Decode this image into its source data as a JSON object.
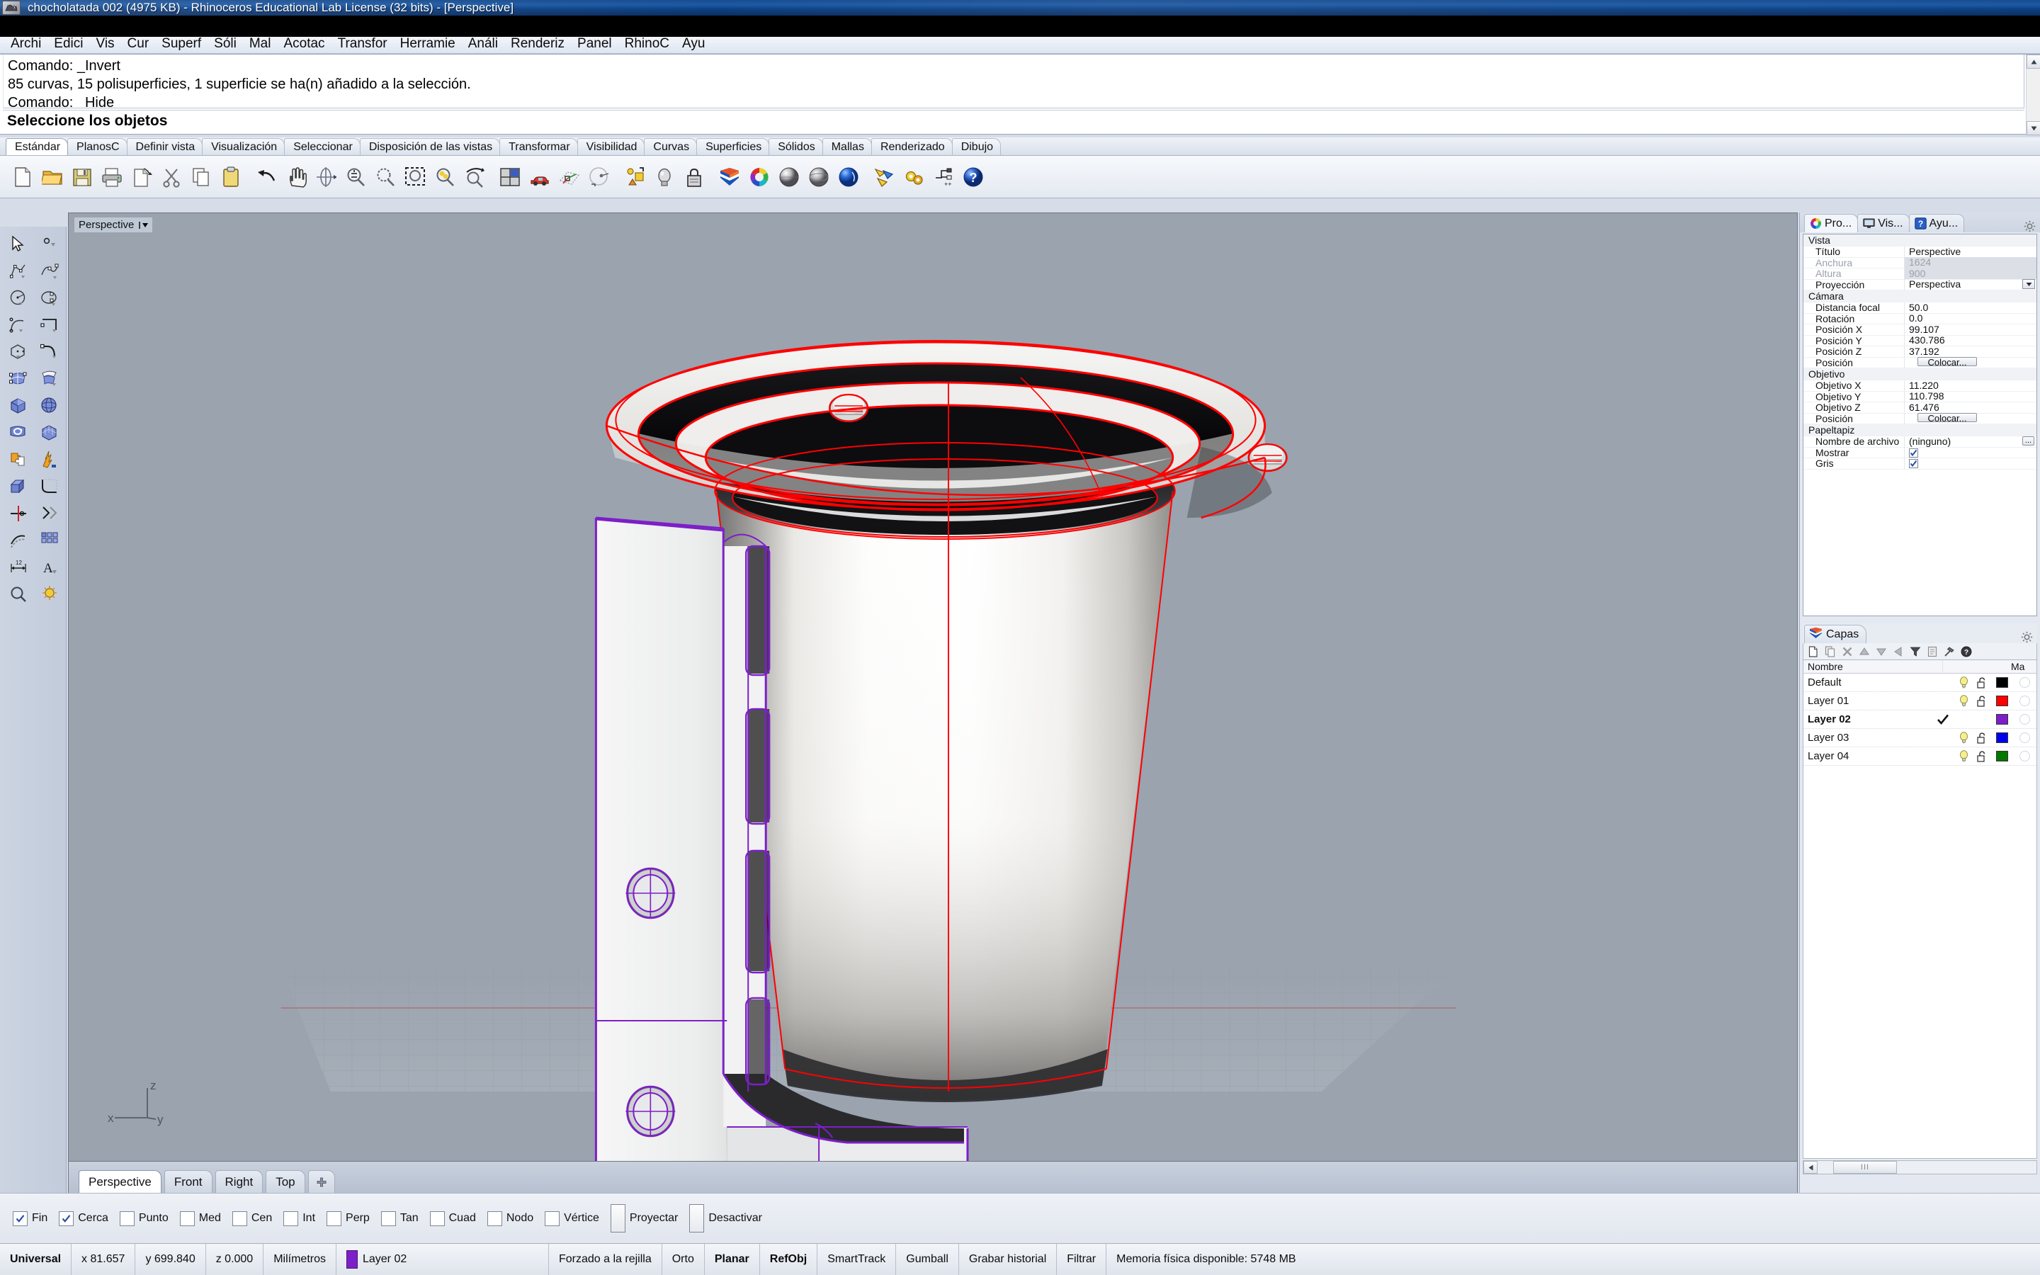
{
  "titlebar": {
    "text": "chocholatada 002 (4975 KB) - Rhinoceros Educational Lab License (32 bits) - [Perspective]",
    "icon": "rhino-logo-icon"
  },
  "menu": {
    "items": [
      {
        "label": "Archi"
      },
      {
        "label": "Edici"
      },
      {
        "label": "Vis"
      },
      {
        "label": "Cur"
      },
      {
        "label": "Superf"
      },
      {
        "label": "Sóli"
      },
      {
        "label": "Mal"
      },
      {
        "label": "Acotac"
      },
      {
        "label": "Transfor"
      },
      {
        "label": "Herramie"
      },
      {
        "label": "Análi"
      },
      {
        "label": "Renderiz"
      },
      {
        "label": "Panel"
      },
      {
        "label": "RhinoC"
      },
      {
        "label": "Ayu"
      }
    ]
  },
  "command": {
    "history": [
      "Comando: _Invert",
      "85 curvas, 15 polisuperficies, 1 superficie se ha(n) añadido a la selección.",
      "Comando: _Hide"
    ],
    "prompt": "Seleccione los objetos"
  },
  "toolbar_tabs": {
    "items": [
      {
        "label": "Estándar",
        "active": true
      },
      {
        "label": "PlanosC",
        "active": false
      },
      {
        "label": "Definir vista",
        "active": false
      },
      {
        "label": "Visualización",
        "active": false
      },
      {
        "label": "Seleccionar",
        "active": false
      },
      {
        "label": "Disposición de las vistas",
        "active": false
      },
      {
        "label": "Transformar",
        "active": false
      },
      {
        "label": "Visibilidad",
        "active": false
      },
      {
        "label": "Curvas",
        "active": false
      },
      {
        "label": "Superficies",
        "active": false
      },
      {
        "label": "Sólidos",
        "active": false
      },
      {
        "label": "Mallas",
        "active": false
      },
      {
        "label": "Renderizado",
        "active": false
      },
      {
        "label": "Dibujo",
        "active": false
      }
    ]
  },
  "main_toolbar": {
    "icons": [
      "new-file-icon",
      "open-folder-icon",
      "save-icon",
      "print-icon",
      "export-icon",
      "cut-scissors-icon",
      "copy-icon",
      "paste-clipboard-icon",
      "undo-arrow-icon",
      "pan-hand-icon",
      "rotate-view-icon",
      "zoom-in-out-icon",
      "zoom-extents-icon",
      "zoom-window-icon",
      "zoom-selected-icon",
      "zoom-dynamic-icon",
      "viewport-layout-icon",
      "render-preview-icon",
      "cplane-icon",
      "named-view-icon",
      "properties-icon",
      "light-bulb-icon",
      "lock-icon",
      "layers-icon",
      "color-wheel-icon",
      "shaded-sphere-icon",
      "rendered-sphere-icon",
      "ghosted-sphere-icon",
      "select-filter-icon",
      "options-gear-icon",
      "macro-icon",
      "help-icon"
    ]
  },
  "side_toolbar": {
    "icons": [
      "select-arrow-icon",
      "point-object-icon",
      "polyline-icon",
      "control-point-curve-icon",
      "circle-icon",
      "ellipse-icon",
      "arc-icon",
      "rectangle-icon",
      "polygon-icon",
      "curve-tools-icon",
      "surface-from-points-icon",
      "loft-surface-icon",
      "box-solid-icon",
      "sphere-solid-icon",
      "revolve-surface-icon",
      "mesh-box-icon",
      "boolean-union-icon",
      "explode-icon",
      "extrude-icon",
      "fillet-icon",
      "trim-icon",
      "split-icon",
      "offset-icon",
      "array-icon",
      "dimension-icon",
      "text-icon",
      "analyze-icon",
      "render-tools-icon"
    ]
  },
  "viewport": {
    "label": "Perspective",
    "axis": {
      "x": "x",
      "y": "y",
      "z": "z"
    },
    "background_color": "#9aa3ae",
    "selected_curve_color": "#ff0000",
    "layer02_color": "#7d1fc8",
    "tabs": [
      {
        "label": "Perspective",
        "active": true
      },
      {
        "label": "Front",
        "active": false
      },
      {
        "label": "Right",
        "active": false
      },
      {
        "label": "Top",
        "active": false
      }
    ],
    "add_tab_icon": "plus-icon"
  },
  "properties_panel": {
    "tabs": [
      {
        "label": "Pro...",
        "icon": "color-wheel-icon",
        "active": true
      },
      {
        "label": "Vis...",
        "icon": "monitor-icon",
        "active": false
      },
      {
        "label": "Ayu...",
        "icon": "help-blue-icon",
        "active": false
      }
    ],
    "gear_icon": "gear-icon",
    "groups": [
      {
        "title": "Vista",
        "rows": [
          {
            "key": "Título",
            "value": "Perspective",
            "style": "normal"
          },
          {
            "key": "Anchura",
            "value": "1624",
            "style": "dim"
          },
          {
            "key": "Altura",
            "value": "900",
            "style": "dim"
          },
          {
            "key": "Proyección",
            "value": "Perspectiva",
            "style": "dropdown"
          }
        ]
      },
      {
        "title": "Cámara",
        "rows": [
          {
            "key": "Distancia focal",
            "value": "50.0",
            "style": "normal"
          },
          {
            "key": "Rotación",
            "value": "0.0",
            "style": "normal"
          },
          {
            "key": "Posición X",
            "value": "99.107",
            "style": "normal"
          },
          {
            "key": "Posición Y",
            "value": "430.786",
            "style": "normal"
          },
          {
            "key": "Posición Z",
            "value": "37.192",
            "style": "normal"
          },
          {
            "key": "Posición",
            "value": "Colocar...",
            "style": "button"
          }
        ]
      },
      {
        "title": "Objetivo",
        "rows": [
          {
            "key": "Objetivo X",
            "value": "11.220",
            "style": "normal"
          },
          {
            "key": "Objetivo Y",
            "value": "110.798",
            "style": "normal"
          },
          {
            "key": "Objetivo Z",
            "value": "61.476",
            "style": "normal"
          },
          {
            "key": "Posición",
            "value": "Colocar...",
            "style": "button"
          }
        ]
      },
      {
        "title": "Papeltapiz",
        "rows": [
          {
            "key": "Nombre de archivo",
            "value": "(ninguno)",
            "style": "ellipsis-button"
          },
          {
            "key": "Mostrar",
            "value": "",
            "style": "checkbox"
          },
          {
            "key": "Gris",
            "value": "",
            "style": "checkbox"
          }
        ]
      }
    ]
  },
  "layers_panel": {
    "tab_label": "Capas",
    "tab_icon": "layers-shield-icon",
    "gear_icon": "gear-icon",
    "toolbar_icons": [
      "new-layer-icon",
      "copy-layer-icon",
      "delete-layer-icon",
      "move-up-icon",
      "move-down-icon",
      "move-left-icon",
      "filter-funnel-icon",
      "layer-props-icon",
      "layer-tools-hammer-icon",
      "layer-help-icon"
    ],
    "columns": [
      "Nombre",
      "",
      "",
      "",
      "",
      "Ma"
    ],
    "rows": [
      {
        "name": "Default",
        "active": false,
        "visible": true,
        "locked": false,
        "color": "#000000"
      },
      {
        "name": "Layer 01",
        "active": false,
        "visible": true,
        "locked": false,
        "color": "#ff0000"
      },
      {
        "name": "Layer 02",
        "active": true,
        "visible": true,
        "locked": false,
        "color": "#7d1fc8"
      },
      {
        "name": "Layer 03",
        "active": false,
        "visible": true,
        "locked": false,
        "color": "#0000ee"
      },
      {
        "name": "Layer 04",
        "active": false,
        "visible": true,
        "locked": false,
        "color": "#007700"
      }
    ]
  },
  "osnap_bar": {
    "items": [
      {
        "label": "Fin",
        "checked": true,
        "tall": false
      },
      {
        "label": "Cerca",
        "checked": true,
        "tall": false
      },
      {
        "label": "Punto",
        "checked": false,
        "tall": false
      },
      {
        "label": "Med",
        "checked": false,
        "tall": false
      },
      {
        "label": "Cen",
        "checked": false,
        "tall": false
      },
      {
        "label": "Int",
        "checked": false,
        "tall": false
      },
      {
        "label": "Perp",
        "checked": false,
        "tall": false
      },
      {
        "label": "Tan",
        "checked": false,
        "tall": false
      },
      {
        "label": "Cuad",
        "checked": false,
        "tall": false
      },
      {
        "label": "Nodo",
        "checked": false,
        "tall": false
      },
      {
        "label": "Vértice",
        "checked": false,
        "tall": false
      },
      {
        "label": "Proyectar",
        "checked": false,
        "tall": true
      },
      {
        "label": "Desactivar",
        "checked": false,
        "tall": true
      }
    ]
  },
  "status_bar": {
    "cells": [
      {
        "text": "Universal",
        "bold": true,
        "type": "text"
      },
      {
        "text": "x 81.657",
        "bold": false,
        "type": "text"
      },
      {
        "text": "y 699.840",
        "bold": false,
        "type": "text"
      },
      {
        "text": "z 0.000",
        "bold": false,
        "type": "text"
      },
      {
        "text": "Milímetros",
        "bold": false,
        "type": "text"
      },
      {
        "text": "Layer 02",
        "bold": false,
        "type": "layer",
        "color": "#7d1fc8"
      },
      {
        "text": "Forzado a la rejilla",
        "bold": false,
        "type": "text"
      },
      {
        "text": "Orto",
        "bold": false,
        "type": "text"
      },
      {
        "text": "Planar",
        "bold": true,
        "type": "text"
      },
      {
        "text": "RefObj",
        "bold": true,
        "type": "text"
      },
      {
        "text": "SmartTrack",
        "bold": false,
        "type": "text"
      },
      {
        "text": "Gumball",
        "bold": false,
        "type": "text"
      },
      {
        "text": "Grabar historial",
        "bold": false,
        "type": "text"
      },
      {
        "text": "Filtrar",
        "bold": false,
        "type": "text"
      },
      {
        "text": "Memoria física disponible: 5748 MB",
        "bold": false,
        "type": "text"
      }
    ]
  }
}
